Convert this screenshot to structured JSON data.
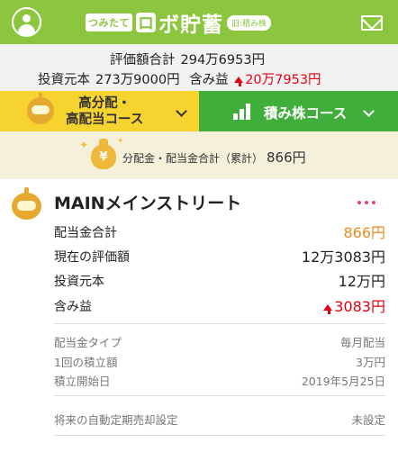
{
  "header": {
    "logo_small": "つみたて",
    "logo_gear": "ロ",
    "logo_main": "ボ貯蓄",
    "logo_badge": "旧:積み株"
  },
  "summary": {
    "total_label": "評価額合計",
    "total_value": "294万6953円",
    "principal_label": "投資元本",
    "principal_value": "273万9000円",
    "gain_label": "含み益",
    "gain_value": "20万7953円"
  },
  "tabs": {
    "course_high_dividend_line1": "高分配・",
    "course_high_dividend_line2": "高配当コース",
    "course_stock": "積み株コース"
  },
  "dividend_band": {
    "bag_symbol": "¥",
    "label": "分配金・配当金合計（累計）",
    "value": "866円"
  },
  "fund": {
    "name": "MAINメインストリート",
    "rows": [
      {
        "label": "配当金合計",
        "value": "866円"
      },
      {
        "label": "現在の評価額",
        "value": "12万3083円"
      },
      {
        "label": "投資元本",
        "value": "12万円"
      },
      {
        "label": "含み益",
        "value": "3083円"
      }
    ],
    "settings": [
      {
        "label": "配当金タイプ",
        "value": "毎月配当"
      },
      {
        "label": "1回の積立額",
        "value": "3万円"
      },
      {
        "label": "積立開始日",
        "value": "2019年5月25日"
      }
    ],
    "auto_sell_label": "将来の自動定期売却設定",
    "auto_sell_value": "未設定"
  },
  "colors": {
    "header_green": "#8cc63f",
    "tab_yellow": "#f7d330",
    "tab_green": "#3fae3a",
    "gain_red": "#e60012",
    "dividend_orange": "#ea8a22"
  },
  "icons": [
    "user-icon",
    "mail-icon",
    "robot-icon",
    "bar-chart-icon",
    "moneybag-icon",
    "more-dots-icon",
    "chevron-down-icon"
  ]
}
